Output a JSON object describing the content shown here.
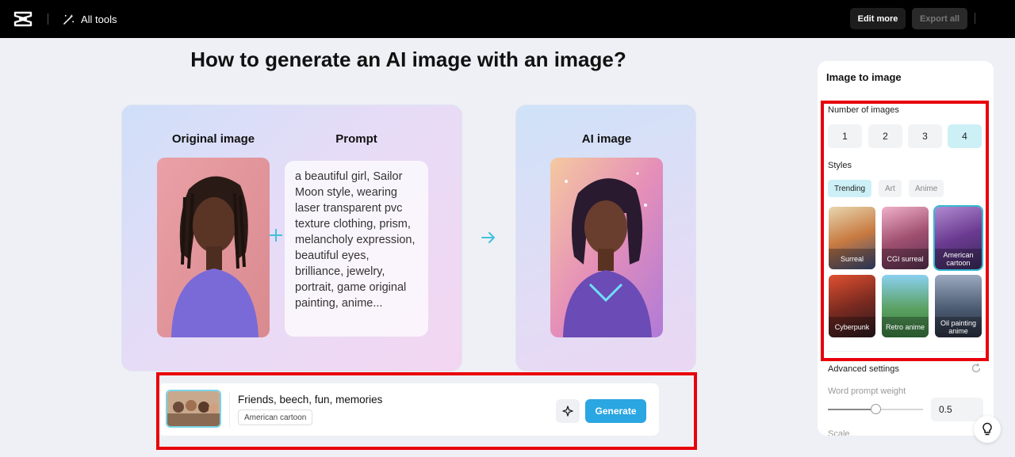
{
  "topbar": {
    "all_tools_label": "All tools",
    "edit_more_label": "Edit more",
    "export_all_label": "Export all"
  },
  "main": {
    "heading": "How to generate an AI image with an image?",
    "card_original_title": "Original image",
    "card_prompt_title": "Prompt",
    "prompt_text": "a beautiful girl, Sailor Moon style, wearing laser transparent pvc texture clothing, prism, melancholy expression, beautiful eyes, brilliance, jewelry, portrait, game original painting, anime...",
    "card_ai_title": "AI image"
  },
  "prompt_bar": {
    "text": "Friends, beech, fun, memories",
    "style_tag": "American cartoon",
    "generate_label": "Generate"
  },
  "panel": {
    "title": "Image to image",
    "number_label": "Number of images",
    "numbers": [
      "1",
      "2",
      "3",
      "4"
    ],
    "selected_number": "4",
    "styles_label": "Styles",
    "style_tabs": [
      "Trending",
      "Art",
      "Anime"
    ],
    "active_tab": "Trending",
    "style_tiles": [
      {
        "label": "Surreal"
      },
      {
        "label": "CGI surreal"
      },
      {
        "label": "American cartoon"
      },
      {
        "label": "Cyberpunk"
      },
      {
        "label": "Retro anime"
      },
      {
        "label": "Oil painting anime"
      }
    ],
    "selected_style": "American cartoon",
    "advanced_label": "Advanced settings",
    "word_weight_label": "Word prompt weight",
    "word_weight_value": "0.5",
    "word_weight_fraction": 0.5,
    "scale_label": "Scale"
  },
  "colors": {
    "accent": "#2aa6e2",
    "selected_bg": "#cdf0f6",
    "highlight_box": "#e8000b"
  }
}
